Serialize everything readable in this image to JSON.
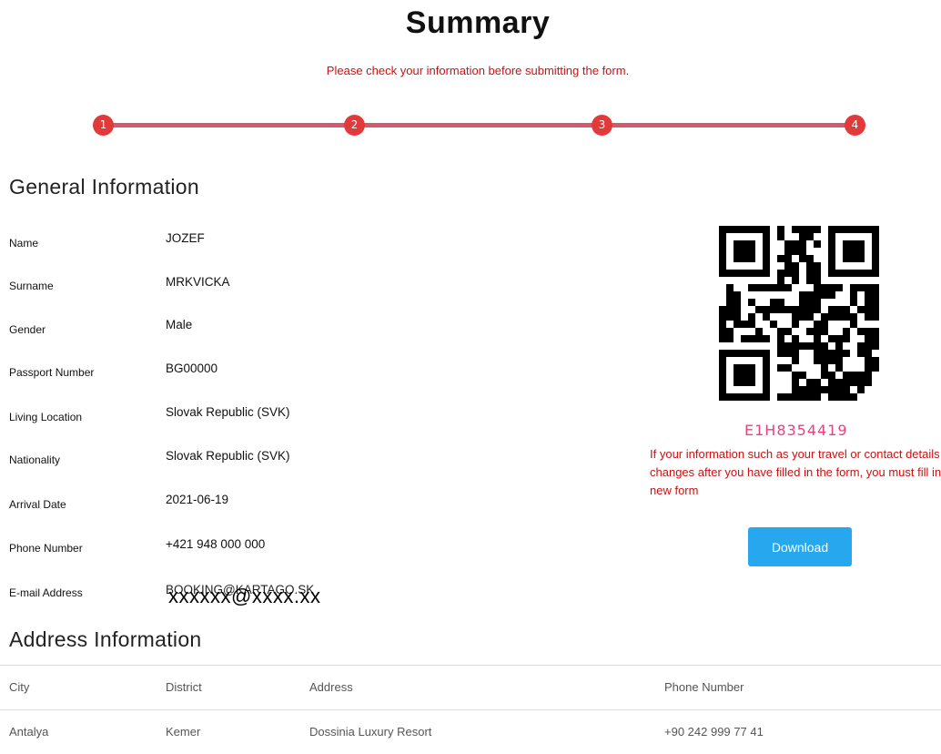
{
  "header": {
    "title": "Summary",
    "subtitle": "Please check your information before submitting the form."
  },
  "stepper": {
    "steps": [
      "1",
      "2",
      "3",
      "4"
    ],
    "current_step": 4,
    "colors": {
      "dot": "#e23a3a",
      "line": "#d6576e"
    }
  },
  "general": {
    "heading": "General Information",
    "fields": [
      {
        "label": "Name",
        "value": "JOZEF"
      },
      {
        "label": "Surname",
        "value": "MRKVICKA"
      },
      {
        "label": "Gender",
        "value": "Male"
      },
      {
        "label": "Passport Number",
        "value": "BG00000"
      },
      {
        "label": "Living Location",
        "value": "Slovak Republic (SVK)"
      },
      {
        "label": "Nationality",
        "value": "Slovak Republic (SVK)"
      },
      {
        "label": "Arrival Date",
        "value": "2021-06-19"
      },
      {
        "label": "Phone Number",
        "value": "+421 948 000 000"
      },
      {
        "label": "E-mail Address",
        "value": "BOOKING@KARTAGO.SK",
        "mask": "xxxxxx@xxxx.xx"
      }
    ]
  },
  "side_panel": {
    "qr_icon": "qr-code-icon",
    "reference_code": "E1H8354419",
    "notice": "If your information such as your travel or contact details changes after you have filled in the form, you must fill in a new form",
    "download_label": "Download",
    "colors": {
      "code": "#e8417e",
      "notice": "#cc1111",
      "button": "#27a8ee"
    }
  },
  "address": {
    "heading": "Address Information",
    "columns": [
      "City",
      "District",
      "Address",
      "Phone Number"
    ],
    "rows": [
      [
        "Antalya",
        "Kemer",
        "Dossinia Luxury Resort",
        "+90 242 999 77 41"
      ]
    ]
  }
}
